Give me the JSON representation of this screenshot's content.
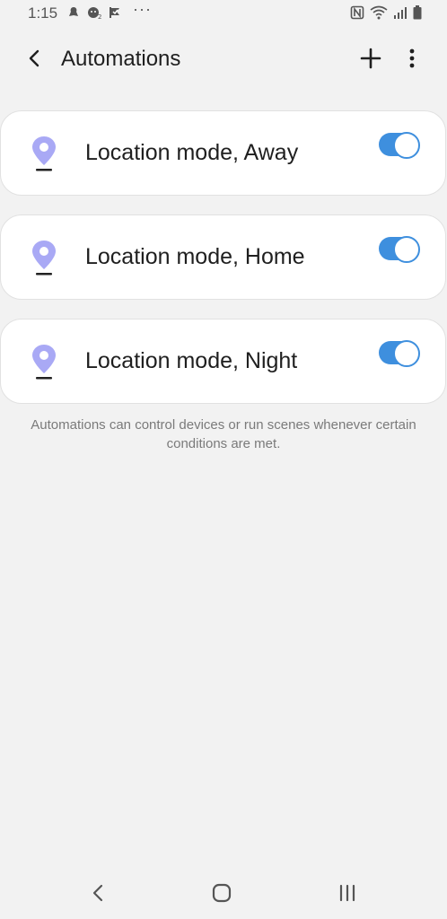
{
  "status_bar": {
    "time": "1:15",
    "more_indicator": "···",
    "icons": [
      "notification-icon",
      "face-icon",
      "check-flag-icon",
      "nfc-icon",
      "wifi-icon",
      "signal-icon",
      "battery-icon"
    ]
  },
  "app_bar": {
    "title": "Automations",
    "back_icon": "chevron-left-icon",
    "add_icon": "plus-icon",
    "more_icon": "more-vertical-icon"
  },
  "automations": [
    {
      "label": "Location mode, Away",
      "enabled": true,
      "icon": "location-pin-icon"
    },
    {
      "label": "Location mode, Home",
      "enabled": true,
      "icon": "location-pin-icon"
    },
    {
      "label": "Location mode, Night",
      "enabled": true,
      "icon": "location-pin-icon"
    }
  ],
  "footer_note": "Automations can control devices or run scenes whenever certain conditions are met.",
  "colors": {
    "background": "#f2f2f2",
    "card": "#ffffff",
    "accent": "#3e8fde",
    "pin": "#a9a9f5",
    "note_text": "#7a7a7a"
  },
  "nav_bar": {
    "icons": [
      "back-icon",
      "home-icon",
      "recents-icon"
    ]
  }
}
